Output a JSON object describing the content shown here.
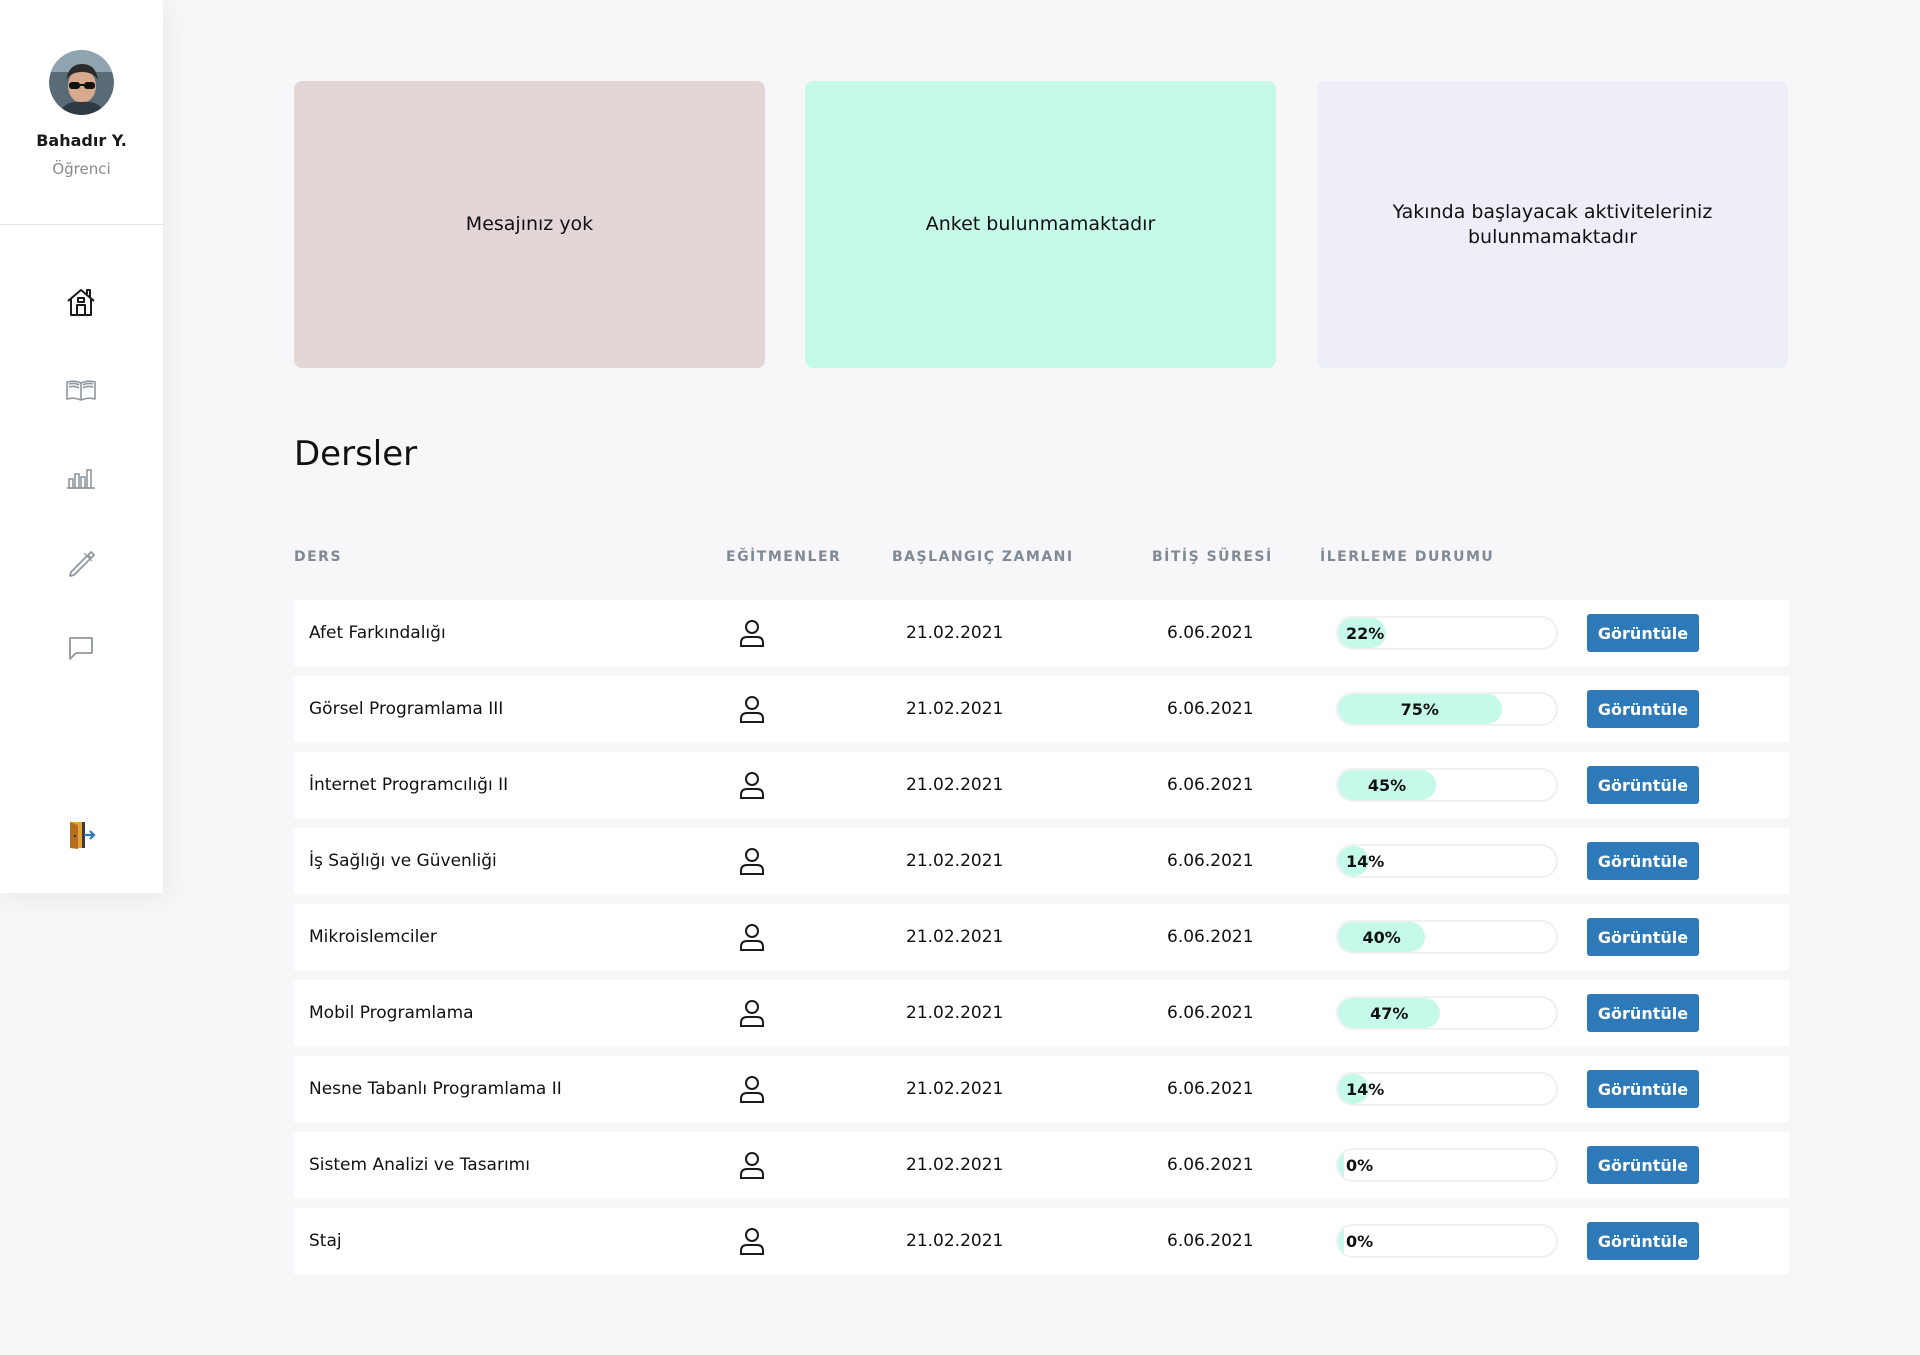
{
  "user": {
    "name": "Bahadır Y.",
    "role": "Öğrenci"
  },
  "nav": [
    {
      "icon": "home-icon"
    },
    {
      "icon": "book-icon"
    },
    {
      "icon": "chart-icon"
    },
    {
      "icon": "pen-icon"
    },
    {
      "icon": "chat-icon"
    },
    {
      "icon": "logout-icon"
    }
  ],
  "cards": {
    "messages": "Mesajınız yok",
    "survey": "Anket bulunmamaktadır",
    "activities": "Yakında başlayacak aktiviteleriniz bulunmamaktadır"
  },
  "colors": {
    "accent": "#2e7ab8",
    "progress": "#c5faea",
    "card_messages": "#e3d6d6",
    "card_survey": "#c5faea",
    "card_activities": "#eeeef8"
  },
  "courses_section": {
    "title": "Dersler",
    "columns": [
      "DERS",
      "EĞİTMENLER",
      "BAŞLANGIÇ ZAMANI",
      "BİTİŞ SÜRESİ",
      "İLERLEME DURUMU"
    ],
    "view_label": "Görüntüle",
    "rows": [
      {
        "name": "Afet Farkındalığı",
        "start": "21.02.2021",
        "end": "6.06.2021",
        "progress": 22,
        "progress_label": "22%"
      },
      {
        "name": "Görsel Programlama III",
        "start": "21.02.2021",
        "end": "6.06.2021",
        "progress": 75,
        "progress_label": "75%"
      },
      {
        "name": "İnternet Programcılığı II",
        "start": "21.02.2021",
        "end": "6.06.2021",
        "progress": 45,
        "progress_label": "45%"
      },
      {
        "name": "İş Sağlığı ve Güvenliği",
        "start": "21.02.2021",
        "end": "6.06.2021",
        "progress": 14,
        "progress_label": "14%"
      },
      {
        "name": "Mikroislemciler",
        "start": "21.02.2021",
        "end": "6.06.2021",
        "progress": 40,
        "progress_label": "40%"
      },
      {
        "name": "Mobil Programlama",
        "start": "21.02.2021",
        "end": "6.06.2021",
        "progress": 47,
        "progress_label": "47%"
      },
      {
        "name": "Nesne Tabanlı Programlama II",
        "start": "21.02.2021",
        "end": "6.06.2021",
        "progress": 14,
        "progress_label": "14%"
      },
      {
        "name": "Sistem Analizi ve Tasarımı",
        "start": "21.02.2021",
        "end": "6.06.2021",
        "progress": 0,
        "progress_label": "0%"
      },
      {
        "name": "Staj",
        "start": "21.02.2021",
        "end": "6.06.2021",
        "progress": 0,
        "progress_label": "0%"
      }
    ]
  }
}
